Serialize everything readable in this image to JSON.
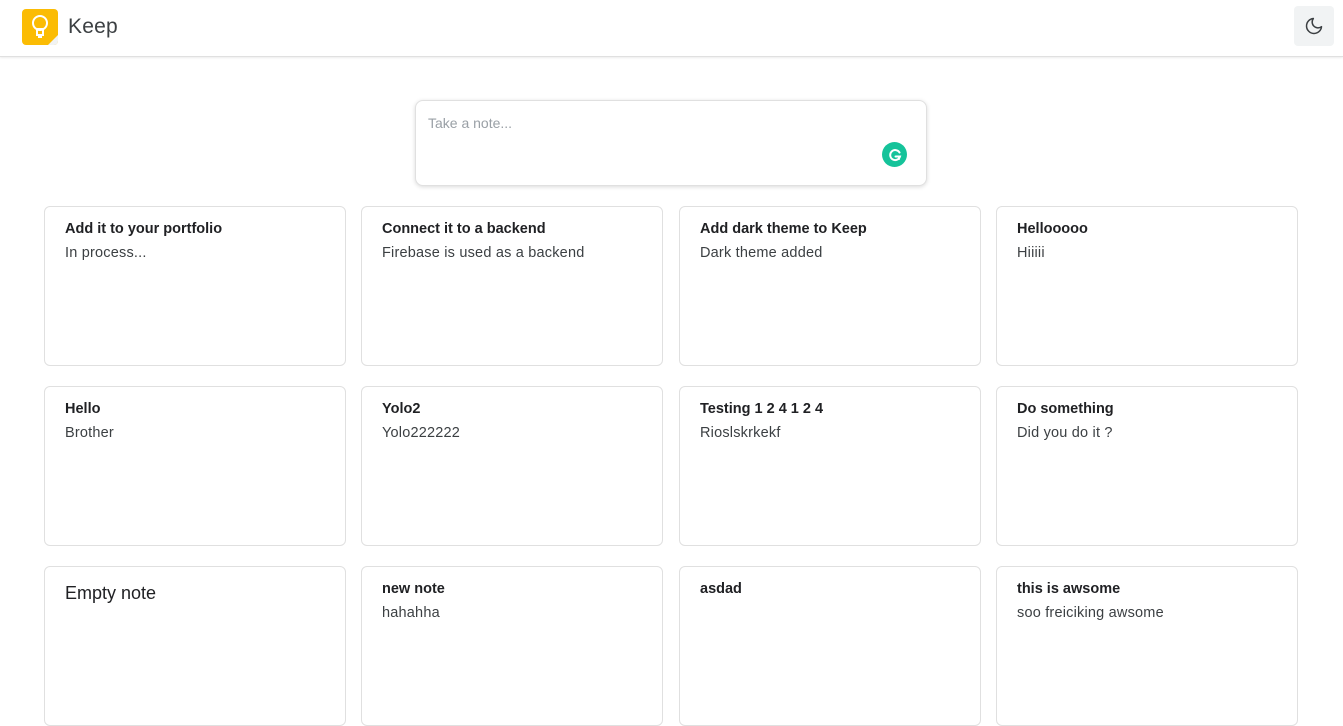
{
  "header": {
    "title": "Keep"
  },
  "icons": {
    "logo": "keep-lightbulb-icon",
    "theme_toggle": "moon-icon",
    "grammarly": "grammarly-icon"
  },
  "colors": {
    "logo": "#fbbc04",
    "grammarly": "#15c39a"
  },
  "composer": {
    "placeholder": "Take a note..."
  },
  "notes": [
    {
      "title": "Add it to your portfolio",
      "body": "In process..."
    },
    {
      "title": "Connect it to a backend",
      "body": "Firebase is used as a backend"
    },
    {
      "title": "Add dark theme to Keep",
      "body": "Dark theme added"
    },
    {
      "title": "Hellooooo",
      "body": "Hiiiii"
    },
    {
      "title": "Hello",
      "body": "Brother"
    },
    {
      "title": "Yolo2",
      "body": "Yolo222222"
    },
    {
      "title": "Testing 1 2 4 1 2 4",
      "body": "Rioslskrkekf"
    },
    {
      "title": "Do something",
      "body": "Did you do it ?"
    },
    {
      "title": "Empty note",
      "body": ""
    },
    {
      "title": "new note",
      "body": "hahahha"
    },
    {
      "title": "asdad",
      "body": ""
    },
    {
      "title": "this is awsome",
      "body": "soo freiciking awsome"
    }
  ]
}
